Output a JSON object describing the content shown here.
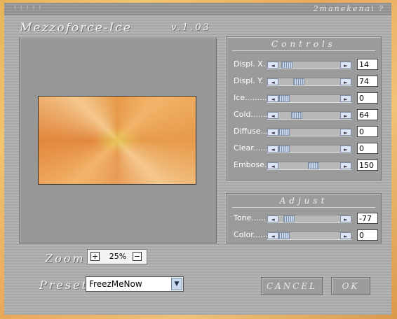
{
  "window": {
    "dots": "⁝⁝⁝⁝⁝",
    "help_link": "2manekenai ?",
    "app_title": "Mezzoforce-Ice",
    "version": "v.1.03"
  },
  "controls_panel": {
    "title": "Controls",
    "rows": [
      {
        "label": "Displ. X.",
        "value": "14",
        "level": 0.06
      },
      {
        "label": "Displ. Y.",
        "value": "74",
        "level": 0.29
      },
      {
        "label": "Ice.........",
        "value": "0",
        "level": 0.0
      },
      {
        "label": "Cold.......",
        "value": "64",
        "level": 0.25
      },
      {
        "label": "Diffuse....",
        "value": "0",
        "level": 0.0
      },
      {
        "label": "Clear......",
        "value": "0",
        "level": 0.0
      },
      {
        "label": "Embose.",
        "value": "150",
        "level": 0.59
      }
    ]
  },
  "adjust_panel": {
    "title": "Adjust",
    "rows": [
      {
        "label": "Tone......",
        "value": "-77",
        "level": 0.1
      },
      {
        "label": "Color......",
        "value": "0",
        "level": 0.0
      }
    ]
  },
  "zoom": {
    "label": "Zoom",
    "plus": "+",
    "minus": "−",
    "value": "25%"
  },
  "preset": {
    "label": "Preset",
    "value": "FreezMeNow"
  },
  "buttons": {
    "cancel": "CANCEL",
    "ok": "OK"
  },
  "icons": {
    "left_arrow": "◄",
    "right_arrow": "►",
    "dropdown": "▼"
  }
}
